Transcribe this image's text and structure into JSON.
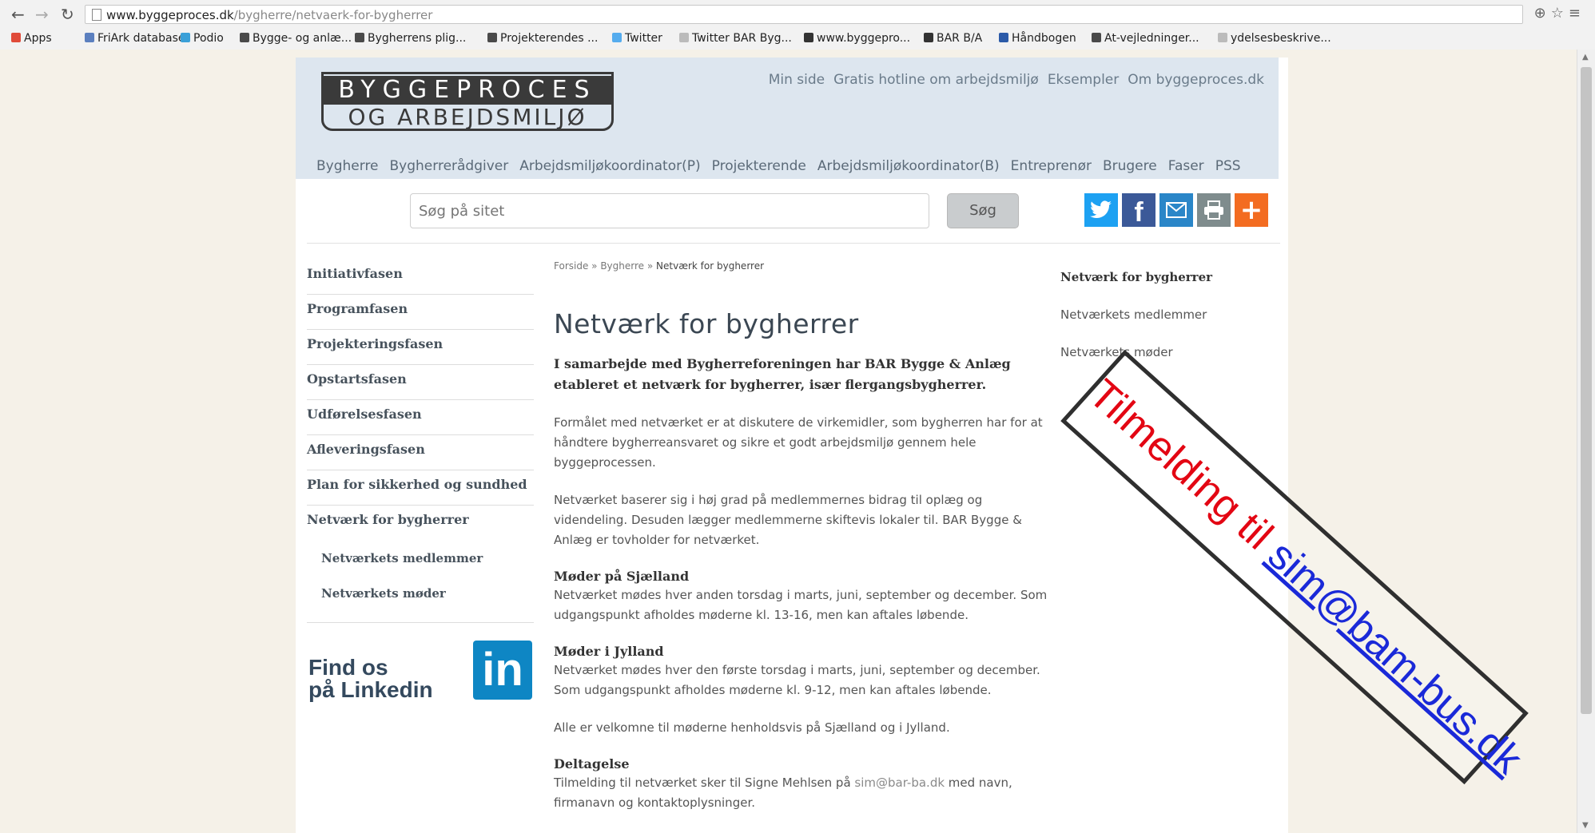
{
  "browser": {
    "url_host": "www.byggeproces.dk",
    "url_path": "/bygherre/netvaerk-for-bygherrer",
    "apps_label": "Apps",
    "bookmarks": [
      {
        "label": "FriArk database",
        "color": "#5b7fbf"
      },
      {
        "label": "Podio",
        "color": "#3aa0d8"
      },
      {
        "label": "Bygge- og anlæ...",
        "color": "#4a4a4a"
      },
      {
        "label": "Bygherrens plig...",
        "color": "#4a4a4a"
      },
      {
        "label": "Projekterendes ...",
        "color": "#4a4a4a"
      },
      {
        "label": "Twitter",
        "color": "#55acee"
      },
      {
        "label": "Twitter BAR Byg...",
        "color": "#bbbbbb"
      },
      {
        "label": "www.byggepro...",
        "color": "#333333"
      },
      {
        "label": "BAR B/A",
        "color": "#333333"
      },
      {
        "label": "Håndbogen",
        "color": "#2b5aa8"
      },
      {
        "label": "At-vejledninger...",
        "color": "#4a4a4a"
      },
      {
        "label": "ydelsesbeskrive...",
        "color": "#bbbbbb"
      }
    ]
  },
  "logo": {
    "line1": "BYGGEPROCES",
    "line2": "OG ARBEJDSMILJØ"
  },
  "top_links": [
    "Min side",
    "Gratis hotline om arbejdsmiljø",
    "Eksempler",
    "Om byggeproces.dk"
  ],
  "main_nav": [
    "Bygherre",
    "Bygherrerådgiver",
    "Arbejdsmiljøkoordinator(P)",
    "Projekterende",
    "Arbejdsmiljøkoordinator(B)",
    "Entreprenør",
    "Brugere",
    "Faser",
    "PSS"
  ],
  "search": {
    "placeholder": "Søg på sitet",
    "button": "Søg"
  },
  "share": {
    "twitter": "#1da1f2",
    "facebook": "#3b5998",
    "mail": "#2a86c8",
    "print": "#7f8c8d",
    "more": "#f36c21"
  },
  "sidebar": {
    "items": [
      "Initiativfasen",
      "Programfasen",
      "Projekteringsfasen",
      "Opstartsfasen",
      "Udførelsesfasen",
      "Afleveringsfasen",
      "Plan for sikkerhed og sundhed",
      "Netværk for bygherrer"
    ],
    "subitems": [
      "Netværkets medlemmer",
      "Netværkets møder"
    ],
    "linkedin_line1": "Find os",
    "linkedin_line2": "på Linkedin",
    "linkedin_logo": "in"
  },
  "breadcrumb": {
    "home": "Forside",
    "sep": " » ",
    "section": "Bygherre",
    "current": "Netværk for bygherrer"
  },
  "content": {
    "title": "Netværk for bygherrer",
    "lead": "I samarbejde med Bygherreforeningen har BAR Bygge & Anlæg etableret et netværk for bygherrer, især flergangsbygherrer.",
    "p1": "Formålet med netværket er at diskutere de virkemidler, som bygherren har for at håndtere bygherreansvaret og sikre et godt arbejdsmiljø gennem hele byggeprocessen.",
    "p2": "Netværket baserer sig i høj grad på medlemmernes bidrag til oplæg og videndeling. Desuden lægger medlemmerne skiftevis lokaler til. BAR Bygge & Anlæg er tovholder for netværket.",
    "h_sjaelland": "Møder på Sjælland",
    "p_sjaelland": "Netværket mødes hver anden torsdag i marts, juni, september og december. Som udgangspunkt afholdes møderne kl. 13-16, men kan aftales løbende.",
    "h_jylland": "Møder i Jylland",
    "p_jylland": "Netværket mødes hver den første torsdag i marts, juni, september og december. Som udgangspunkt afholdes møderne kl. 9-12, men kan aftales løbende.",
    "p_welcome": "Alle er velkomne til møderne henholdsvis på Sjælland og i Jylland.",
    "h_deltagelse": "Deltagelse",
    "p_deltagelse_pre": "Tilmelding til netværket sker til Signe Mehlsen på ",
    "p_deltagelse_email": "sim@bar-ba.dk",
    "p_deltagelse_post": " med navn, firmanavn og kontaktoplysninger."
  },
  "right_nav": [
    "Netværk for bygherrer",
    "Netværkets medlemmer",
    "Netværkets møder"
  ],
  "stamp": {
    "prefix": "Tilmelding til ",
    "email": "sim@bam-bus.dk"
  }
}
